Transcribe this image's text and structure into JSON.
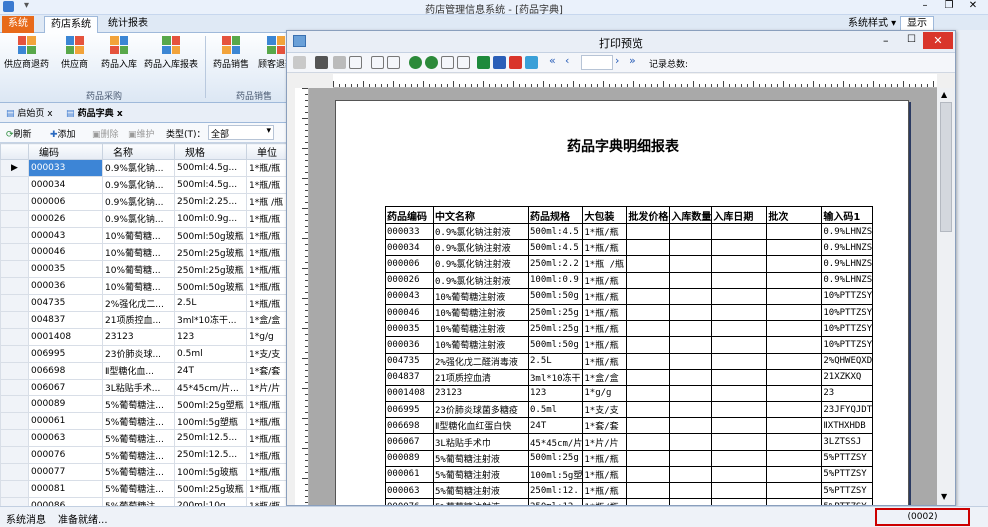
{
  "app": {
    "title": "药店管理信息系统 - [药品字典]",
    "menu_btn": "系统",
    "tabs": [
      "药店系统",
      "统计报表"
    ],
    "style_label": "系统样式",
    "display_btn": "显示"
  },
  "ribbon": {
    "buttons": [
      "供应商退药",
      "供应商",
      "药品入库",
      "药品入库报表",
      "药品销售",
      "顾客退药"
    ],
    "groups": [
      "药品采购",
      "药品销售"
    ]
  },
  "doctabs": [
    {
      "label": "启始页"
    },
    {
      "label": "药品字典"
    }
  ],
  "toolbar": {
    "refresh": "刷新",
    "add": "添加",
    "delete": "删除",
    "maintain": "维护",
    "type_label": "类型(T)：",
    "type_value": "全部"
  },
  "grid": {
    "headers": [
      "编码",
      "名称",
      "规格",
      "单位"
    ],
    "rows": [
      [
        "000033",
        "0.9%氯化钠...",
        "500ml:4.5g...",
        "1*瓶/瓶"
      ],
      [
        "000034",
        "0.9%氯化钠...",
        "500ml:4.5g...",
        "1*瓶/瓶"
      ],
      [
        "000006",
        "0.9%氯化钠...",
        "250ml:2.25...",
        "1*瓶 /瓶"
      ],
      [
        "000026",
        "0.9%氯化钠...",
        "100ml:0.9g...",
        "1*瓶/瓶"
      ],
      [
        "000043",
        "10%葡萄糖...",
        "500ml:50g玻瓶",
        "1*瓶/瓶"
      ],
      [
        "000046",
        "10%葡萄糖...",
        "250ml:25g玻瓶",
        "1*瓶/瓶"
      ],
      [
        "000035",
        "10%葡萄糖...",
        "250ml:25g玻瓶",
        "1*瓶/瓶"
      ],
      [
        "000036",
        "10%葡萄糖...",
        "500ml:50g玻瓶",
        "1*瓶/瓶"
      ],
      [
        "004735",
        "2%强化戊二...",
        "2.5L",
        "1*瓶/瓶"
      ],
      [
        "004837",
        "21项质控血...",
        "3ml*10冻干...",
        "1*盒/盒"
      ],
      [
        "0001408",
        "23123",
        "123",
        "1*g/g"
      ],
      [
        "006995",
        "23价肺炎球...",
        "0.5ml",
        "1*支/支"
      ],
      [
        "006698",
        "Ⅱ型糖化血...",
        "24T",
        "1*套/套"
      ],
      [
        "006067",
        "3L粘贴手术...",
        "45*45cm/片...",
        "1*片/片"
      ],
      [
        "000089",
        "5%葡萄糖注...",
        "500ml:25g塑瓶",
        "1*瓶/瓶"
      ],
      [
        "000061",
        "5%葡萄糖注...",
        "100ml:5g塑瓶",
        "1*瓶/瓶"
      ],
      [
        "000063",
        "5%葡萄糖注...",
        "250ml:12.5...",
        "1*瓶/瓶"
      ],
      [
        "000076",
        "5%葡萄糖注...",
        "250ml:12.5...",
        "1*瓶/瓶"
      ],
      [
        "000077",
        "5%葡萄糖注...",
        "100ml:5g玻瓶",
        "1*瓶/瓶"
      ],
      [
        "000081",
        "5%葡萄糖注...",
        "500ml:25g玻瓶",
        "1*瓶/瓶"
      ],
      [
        "000086",
        "5%葡萄糖注...",
        "200ml:10g...",
        "1*瓶/瓶"
      ]
    ]
  },
  "preview": {
    "title": "打印预览",
    "record_label": "记录总数:",
    "report_title": "药品字典明细报表",
    "headers": [
      "药品编码",
      "中文名称",
      "药品规格",
      "大包装",
      "批发价格",
      "入库数量",
      "入库日期",
      "批次",
      "输入码1"
    ],
    "rows": [
      [
        "000033",
        "0.9%氯化钠注射液",
        "500ml:4.5",
        "1*瓶/瓶",
        "",
        "",
        "",
        "",
        "0.9%LHNZS"
      ],
      [
        "000034",
        "0.9%氯化钠注射液",
        "500ml:4.5",
        "1*瓶/瓶",
        "",
        "",
        "",
        "",
        "0.9%LHNZS"
      ],
      [
        "000006",
        "0.9%氯化钠注射液",
        "250ml:2.2",
        "1*瓶 /瓶",
        "",
        "",
        "",
        "",
        "0.9%LHNZS"
      ],
      [
        "000026",
        "0.9%氯化钠注射液",
        "100ml:0.9",
        "1*瓶/瓶",
        "",
        "",
        "",
        "",
        "0.9%LHNZS"
      ],
      [
        "000043",
        "10%葡萄糖注射液",
        "500ml:50g",
        "1*瓶/瓶",
        "",
        "",
        "",
        "",
        "10%PTTZSY"
      ],
      [
        "000046",
        "10%葡萄糖注射液",
        "250ml:25g",
        "1*瓶/瓶",
        "",
        "",
        "",
        "",
        "10%PTTZSY"
      ],
      [
        "000035",
        "10%葡萄糖注射液",
        "250ml:25g",
        "1*瓶/瓶",
        "",
        "",
        "",
        "",
        "10%PTTZSY"
      ],
      [
        "000036",
        "10%葡萄糖注射液",
        "500ml:50g",
        "1*瓶/瓶",
        "",
        "",
        "",
        "",
        "10%PTTZSY"
      ],
      [
        "004735",
        "2%强化戊二醛消毒液",
        "2.5L",
        "1*瓶/瓶",
        "",
        "",
        "",
        "",
        "2%QHWEQXD"
      ],
      [
        "004837",
        "21项质控血清",
        "3ml*10冻干",
        "1*盒/盒",
        "",
        "",
        "",
        "",
        "21XZKXQ"
      ],
      [
        "0001408",
        "23123",
        "123",
        "1*g/g",
        "",
        "",
        "",
        "",
        "23"
      ],
      [
        "006995",
        "23价肺炎球菌多糖疫",
        "0.5ml",
        "1*支/支",
        "",
        "",
        "",
        "",
        "23JFYQJDT"
      ],
      [
        "006698",
        "Ⅱ型糖化血红蛋白快",
        "24T",
        "1*套/套",
        "",
        "",
        "",
        "",
        "ⅡXTHXHDB"
      ],
      [
        "006067",
        "3L粘贴手术巾",
        "45*45cm/片",
        "1*片/片",
        "",
        "",
        "",
        "",
        "3LZTSSJ"
      ],
      [
        "000089",
        "5%葡萄糖注射液",
        "500ml:25g",
        "1*瓶/瓶",
        "",
        "",
        "",
        "",
        "5%PTTZSY"
      ],
      [
        "000061",
        "5%葡萄糖注射液",
        "100ml:5g塑",
        "1*瓶/瓶",
        "",
        "",
        "",
        "",
        "5%PTTZSY"
      ],
      [
        "000063",
        "5%葡萄糖注射液",
        "250ml:12.",
        "1*瓶/瓶",
        "",
        "",
        "",
        "",
        "5%PTTZSY"
      ],
      [
        "000076",
        "5%葡萄糖注射液",
        "250ml:12.",
        "1*瓶/瓶",
        "",
        "",
        "",
        "",
        "5%PTTZSY"
      ]
    ]
  },
  "status": {
    "label": "系统消息",
    "text": "准备就绪...",
    "count": "(0002)"
  },
  "colors": {
    "accent": "#e86a1a",
    "selection": "#3d85d6",
    "highlight": "#cc0000"
  }
}
